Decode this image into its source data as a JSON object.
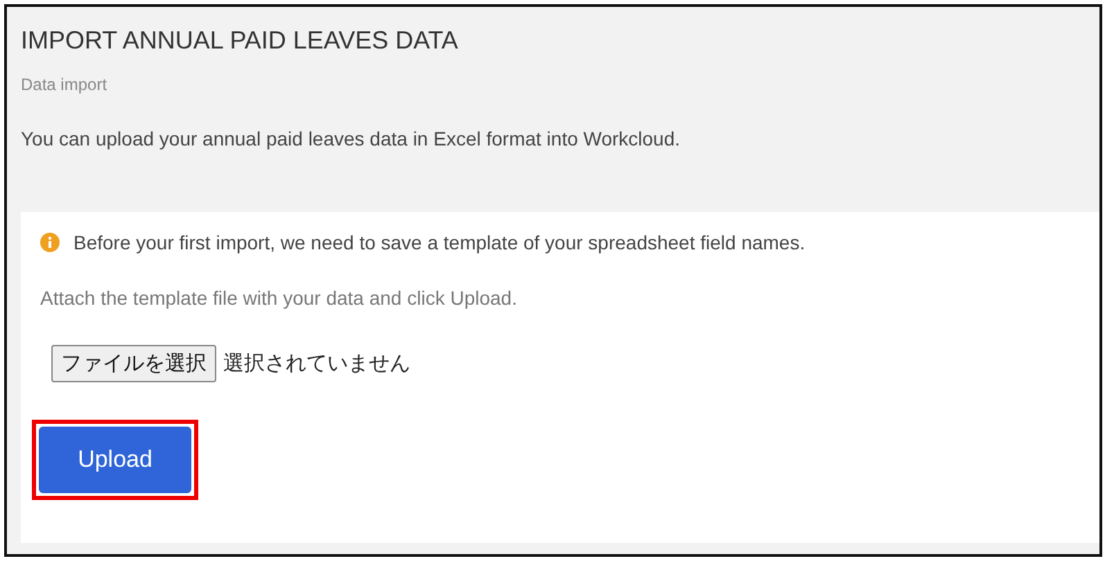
{
  "header": {
    "title": "IMPORT ANNUAL PAID LEAVES DATA",
    "subtitle": "Data import",
    "description": "You can upload your annual paid leaves data in Excel format into Workcloud."
  },
  "notice": {
    "text": "Before your first import, we need to save a template of your spreadsheet field names."
  },
  "instruction": "Attach the template file with your data and click Upload.",
  "file_picker": {
    "button": "ファイルを選択",
    "status": "選択されていません"
  },
  "upload_button": {
    "label": "Upload",
    "highlighted": true
  }
}
